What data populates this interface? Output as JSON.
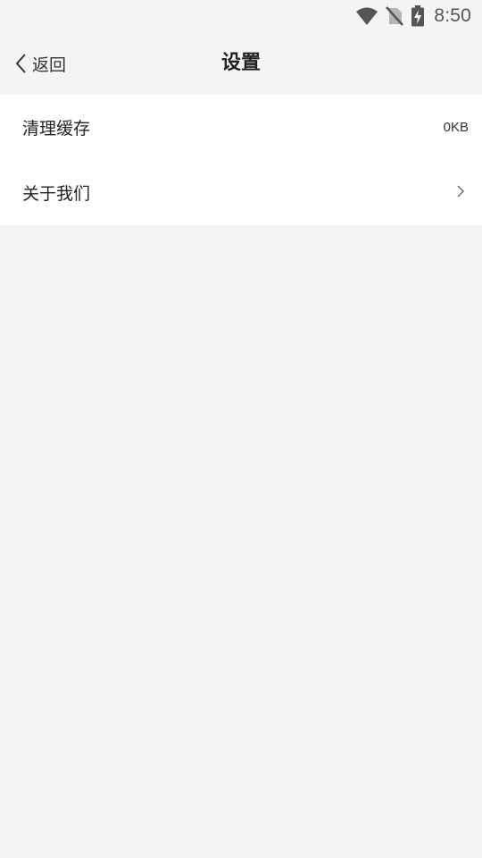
{
  "status_bar": {
    "time": "8:50",
    "icons": [
      "wifi-icon",
      "no-sim-icon",
      "battery-charging-icon"
    ]
  },
  "nav": {
    "back_label": "返回",
    "back_icon": "chevron-left-icon",
    "title": "设置"
  },
  "settings": {
    "items": [
      {
        "label": "清理缓存",
        "value": "0KB"
      },
      {
        "label": "关于我们",
        "icon": "chevron-right-icon"
      }
    ]
  },
  "colors": {
    "background": "#f4f4f4",
    "surface": "#ffffff",
    "text_primary": "#222222",
    "icon_gray": "#555555"
  }
}
